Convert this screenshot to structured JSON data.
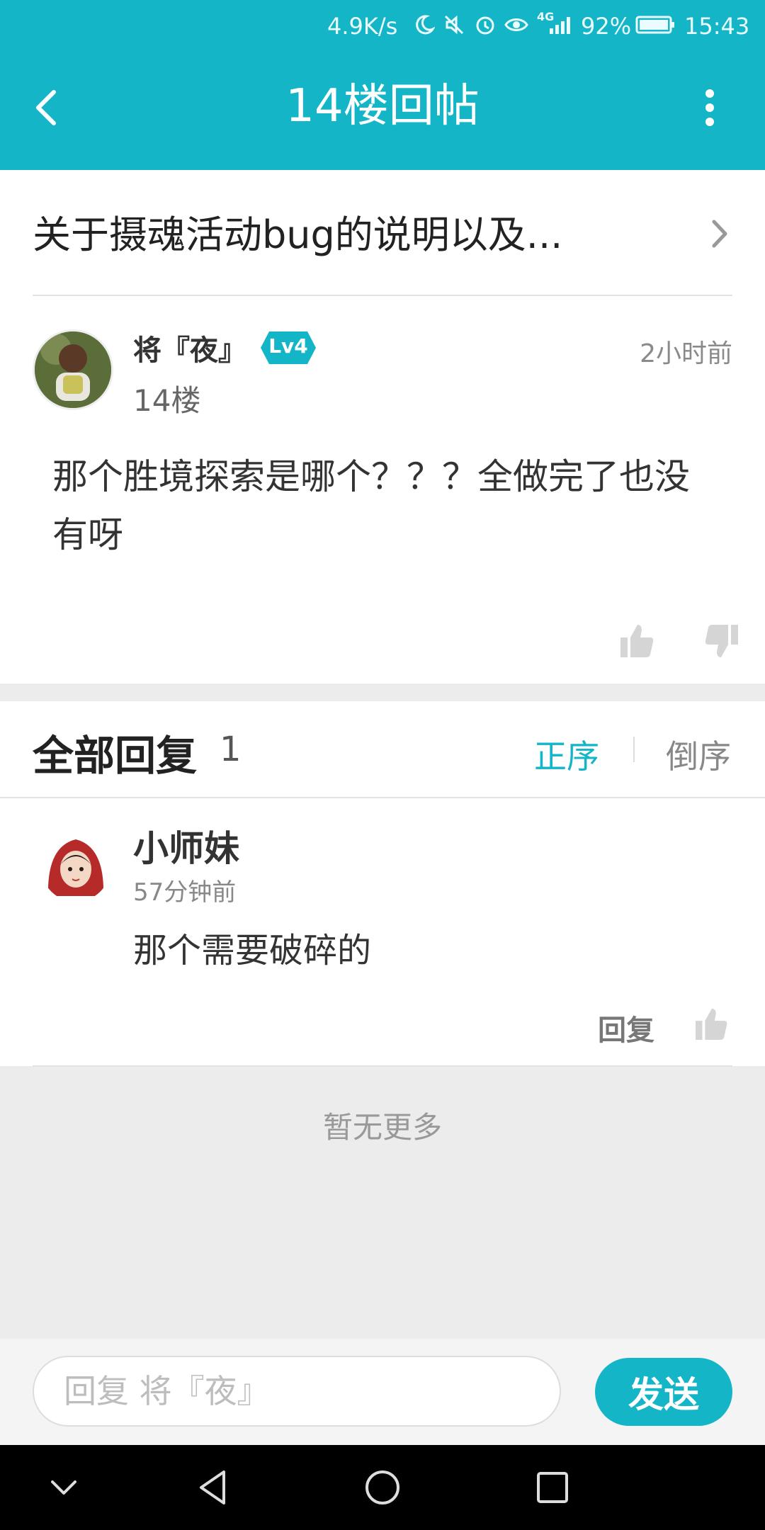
{
  "status_bar": {
    "speed": "4.9K/s",
    "signal_label": "4G",
    "battery_percent": "92%",
    "time": "15:43",
    "icons": [
      "moon-icon",
      "mute-icon",
      "alarm-icon",
      "eye-icon",
      "signal-icon",
      "battery-icon"
    ]
  },
  "header": {
    "title": "14楼回帖"
  },
  "thread": {
    "title": "关于摄魂活动bug的说明以及..."
  },
  "post": {
    "author": "将『夜』",
    "level": "Lv4",
    "floor": "14楼",
    "time": "2小时前",
    "content": "那个胜境探索是哪个？？？全做完了也没有呀"
  },
  "replies": {
    "title": "全部回复",
    "count": "1",
    "sort_asc": "正序",
    "sort_desc": "倒序",
    "items": [
      {
        "author": "小师妹",
        "time": "57分钟前",
        "content": "那个需要破碎的",
        "reply_label": "回复"
      }
    ],
    "no_more": "暂无更多"
  },
  "composer": {
    "placeholder": "回复 将『夜』",
    "send_label": "发送"
  },
  "colors": {
    "accent": "#14b5c6",
    "background": "#ececec"
  }
}
